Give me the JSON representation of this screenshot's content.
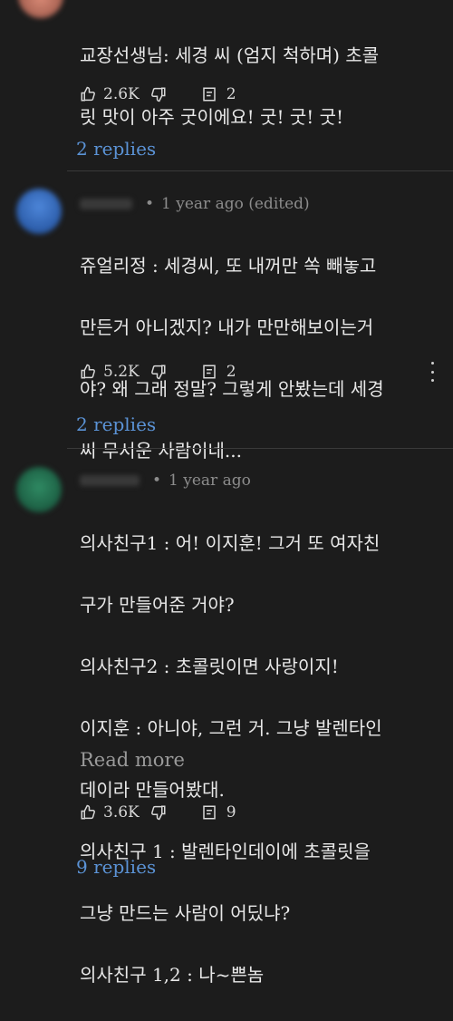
{
  "colors": {
    "background": "#1c1c1c",
    "link": "#5b93d6",
    "muted": "#8c8c8c"
  },
  "comments": [
    {
      "avatar_color": "#c0735f",
      "lines": [
        "교장선생님: 세경 씨 (엄지 척하며) 초콜",
        "릿 맛이 아주 굿이에요! 굿! 굿! 굿!"
      ],
      "likes": "2.6K",
      "reply_count": "2",
      "replies_link": "2 replies"
    },
    {
      "avatar_color": "#2f64b8",
      "time": "1 year ago (edited)",
      "lines": [
        "쥬얼리정 : 세경씨, 또 내꺼만 쏙 빼놓고",
        "만든거 아니겠지? 내가 만만해보이는거",
        "야? 왜 그래 정말? 그렇게 안봤는데 세경",
        "씨 무서운 사람이네..."
      ],
      "likes": "5.2K",
      "reply_count": "2",
      "replies_link": "2 replies"
    },
    {
      "avatar_color": "#1f6b4e",
      "time": "1 year ago",
      "lines": [
        "의사친구1 : 어! 이지훈! 그거 또 여자친",
        "구가 만들어준 거야?",
        "의사친구2 : 초콜릿이면 사랑이지!",
        "이지훈 : 아니야, 그런 거. 그냥 발렌타인",
        "데이라 만들어봤대.",
        "의사친구 1 : 발렌타인데이에 초콜릿을",
        "그냥 만드는 사람이 어딨냐?",
        "의사친구 1,2 : 나~쁜놈"
      ],
      "read_more": "Read more",
      "likes": "3.6K",
      "reply_count": "9",
      "replies_link": "9 replies"
    }
  ],
  "dot_separator": "•",
  "icons": {
    "like": "thumbs-up-icon",
    "dislike": "thumbs-down-icon",
    "reply": "reply-icon",
    "more": "more-vertical-icon"
  }
}
